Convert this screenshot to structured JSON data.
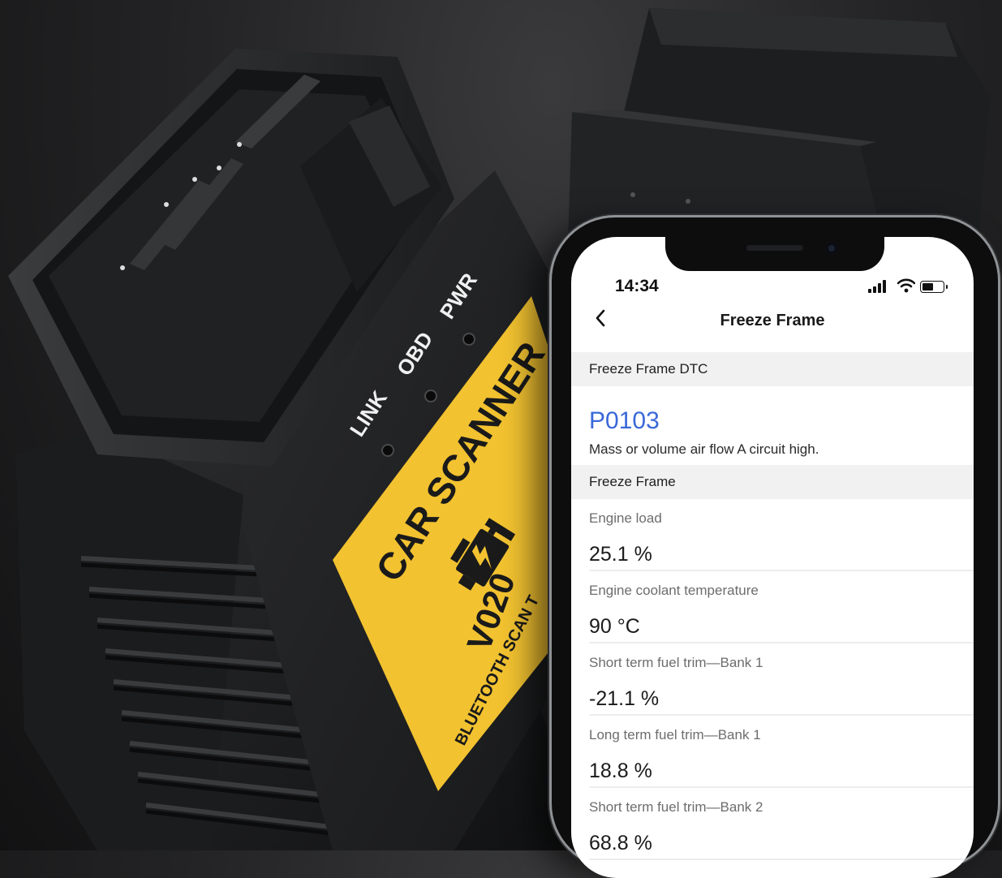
{
  "device": {
    "led_labels": [
      "LINK",
      "OBD",
      "PWR"
    ],
    "brand_text": "CAR SCANNER",
    "model_text": "V020",
    "subtitle_text": "BLUETOOTH SCAN T",
    "accent_color": "#f2c230"
  },
  "phone": {
    "status": {
      "time": "14:34"
    },
    "nav": {
      "back_icon": "chevron-left",
      "title": "Freeze Frame"
    },
    "dtc_section": {
      "header": "Freeze Frame DTC",
      "code": "P0103",
      "description": "Mass or volume air flow A circuit high."
    },
    "freeze_section": {
      "header": "Freeze Frame",
      "rows": [
        {
          "label": "Engine load",
          "value": "25.1 %"
        },
        {
          "label": "Engine coolant temperature",
          "value": "90 °C"
        },
        {
          "label": "Short term fuel trim—Bank 1",
          "value": "-21.1 %"
        },
        {
          "label": "Long term fuel trim—Bank 1",
          "value": "18.8 %"
        },
        {
          "label": "Short term fuel trim—Bank 2",
          "value": "68.8 %"
        }
      ]
    },
    "colors": {
      "dtc_code": "#3a68d8"
    }
  }
}
